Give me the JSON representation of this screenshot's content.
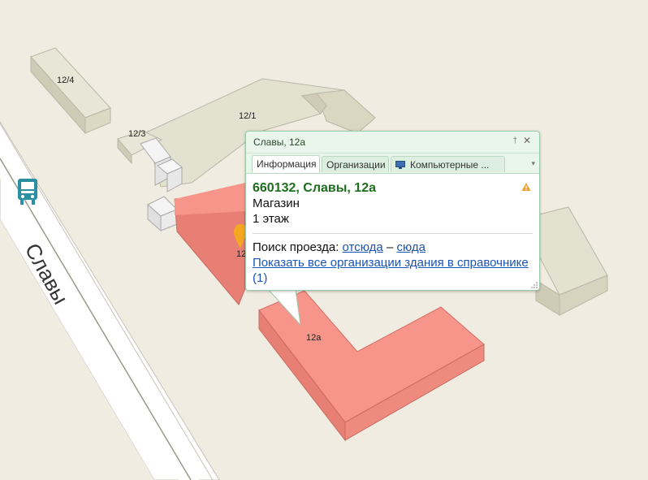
{
  "map": {
    "street_name": "Славы",
    "bus_stop_icon": "bus-icon",
    "buildings": {
      "b12_4": "12/4",
      "b12_1": "12/1",
      "b12_3": "12/3",
      "b12a": "12а",
      "partial_label": "12"
    },
    "colors": {
      "background": "#f1ece1",
      "road": "#ffffff",
      "building": "#e2e0cf",
      "selected_building": "#f8958a",
      "popup_border": "#9ccaa9",
      "address_green": "#1e6e1e",
      "link_blue": "#1a55b3"
    }
  },
  "popup": {
    "title": "Славы, 12а",
    "pin_icon": "pin-icon",
    "close_icon": "close-icon",
    "tabs": [
      {
        "label": "Информация",
        "active": true
      },
      {
        "label": "Организации",
        "active": false
      },
      {
        "label": "Компьютерные ...",
        "active": false,
        "icon": "monitor-icon"
      }
    ],
    "address": "660132, Славы, 12а",
    "type": "Магазин",
    "floors": "1 этаж",
    "route_label": "Поиск проезда:",
    "route_from": "отсюда",
    "route_dash": "–",
    "route_to": "сюда",
    "show_all_link": "Показать все организации здания в справочнике",
    "show_all_count": "(1)",
    "warning_icon": "warning-icon"
  }
}
